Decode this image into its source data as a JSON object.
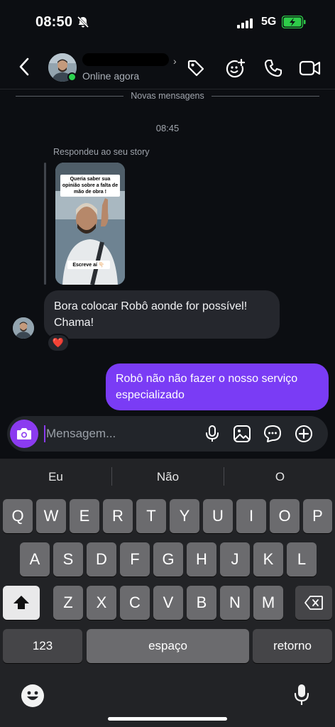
{
  "status_bar": {
    "time": "08:50",
    "network": "5G"
  },
  "header": {
    "status": "Online agora",
    "icons": [
      "chevron-left-icon",
      "tag-icon",
      "sticker-add-icon",
      "phone-icon",
      "video-icon"
    ]
  },
  "chat": {
    "divider_label": "Novas mensagens",
    "timestamp": "08:45",
    "replied_label": "Respondeu ao seu story",
    "story": {
      "question": "Queria saber sua opinião sobre a falta de mão de obra !",
      "answer_prompt": "Escreve aí 👇🏻"
    },
    "incoming_message": "Bora colocar  Robô aonde for possível! Chama!",
    "reaction": "❤️",
    "outgoing_message": "Robô não não fazer o nosso serviço especializado"
  },
  "composer": {
    "placeholder": "Mensagem..."
  },
  "keyboard": {
    "suggestions": [
      "Eu",
      "Não",
      "O"
    ],
    "row1": [
      "Q",
      "W",
      "E",
      "R",
      "T",
      "Y",
      "U",
      "I",
      "O",
      "P"
    ],
    "row2": [
      "A",
      "S",
      "D",
      "F",
      "G",
      "H",
      "J",
      "K",
      "L"
    ],
    "row3": [
      "Z",
      "X",
      "C",
      "V",
      "B",
      "N",
      "M"
    ],
    "numbers_label": "123",
    "space_label": "espaço",
    "return_label": "retorno"
  },
  "colors": {
    "accent": "#7a3cf5",
    "online": "#2bd24f",
    "background": "#0c0e12"
  }
}
